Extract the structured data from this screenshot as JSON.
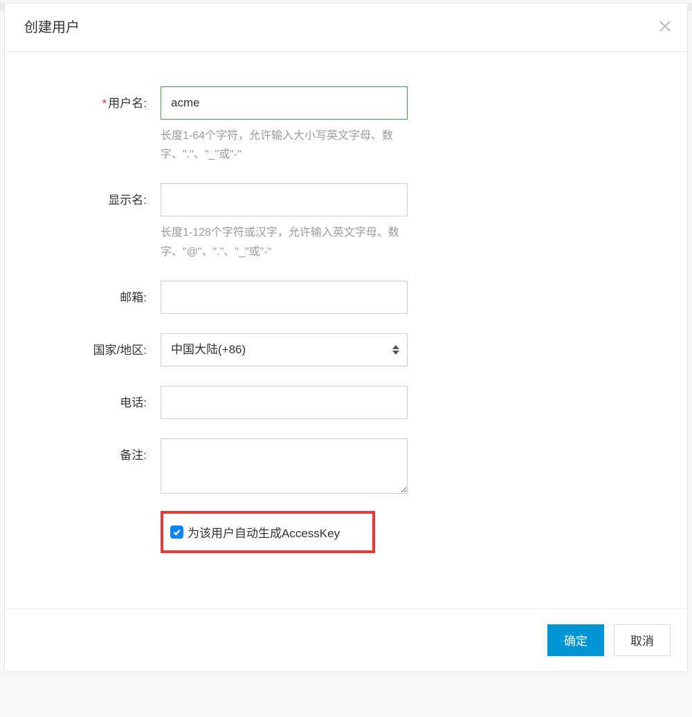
{
  "dialog": {
    "title": "创建用户",
    "fields": {
      "username": {
        "label": "用户名:",
        "required_mark": "*",
        "value": "acme",
        "help": "长度1-64个字符，允许输入大小写英文字母、数字、\".\"、\"_\"或\"-\""
      },
      "display_name": {
        "label": "显示名:",
        "value": "",
        "help": "长度1-128个字符或汉字，允许输入英文字母、数字、\"@\"、\".\"、\"_\"或\"-\""
      },
      "email": {
        "label": "邮箱:",
        "value": ""
      },
      "country": {
        "label": "国家/地区:",
        "selected": "中国大陆(+86)"
      },
      "phone": {
        "label": "电话:",
        "value": ""
      },
      "remarks": {
        "label": "备注:",
        "value": ""
      },
      "access_key": {
        "label": "为该用户自动生成AccessKey",
        "checked": true
      }
    },
    "footer": {
      "confirm": "确定",
      "cancel": "取消"
    }
  }
}
